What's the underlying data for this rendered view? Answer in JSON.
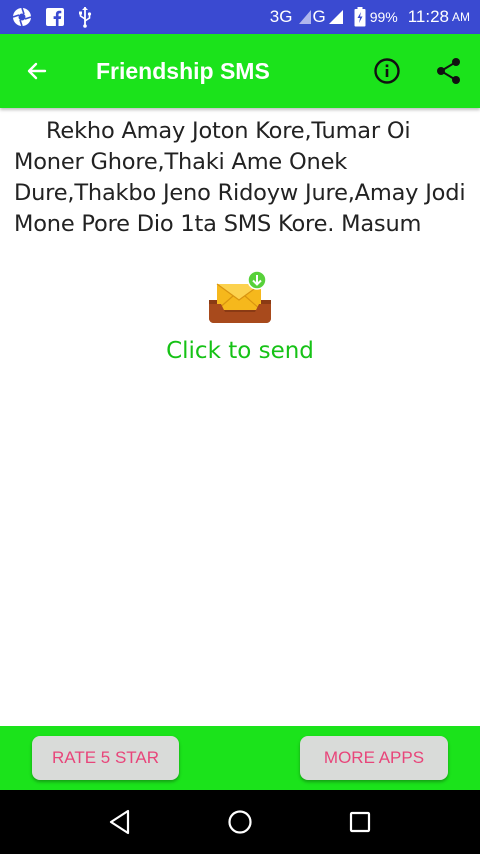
{
  "status_bar": {
    "network_3g": "3G",
    "network_g": "G",
    "battery_percent": "99%",
    "time": "11:28",
    "ampm": "AM",
    "icons": [
      "aperture-icon",
      "facebook-icon",
      "usb-icon",
      "signal-icon",
      "battery-icon"
    ]
  },
  "app_bar": {
    "title": "Friendship SMS",
    "back_icon": "arrow-back-icon",
    "info_icon": "info-icon",
    "share_icon": "share-icon"
  },
  "content": {
    "message": "Rekho Amay Joton Kore,Tumar Oi Moner Ghore,Thaki Ame Onek Dure,Thakbo Jeno Ridoyw Jure,Amay Jodi Mone Pore Dio 1ta SMS Kore. Masum",
    "send_label": "Click to send",
    "send_icon": "mail-send-icon"
  },
  "bottom_bar": {
    "rate_label": "RATE 5 STAR",
    "more_label": "MORE APPS"
  },
  "nav_bar": {
    "icons": [
      "nav-back-icon",
      "nav-home-icon",
      "nav-recents-icon"
    ]
  },
  "colors": {
    "status_bar": "#3a4ad1",
    "app_bar": "#1be31b",
    "send_label": "#16c216",
    "button_text": "#e8457a",
    "button_bg": "#d9dbd9"
  }
}
